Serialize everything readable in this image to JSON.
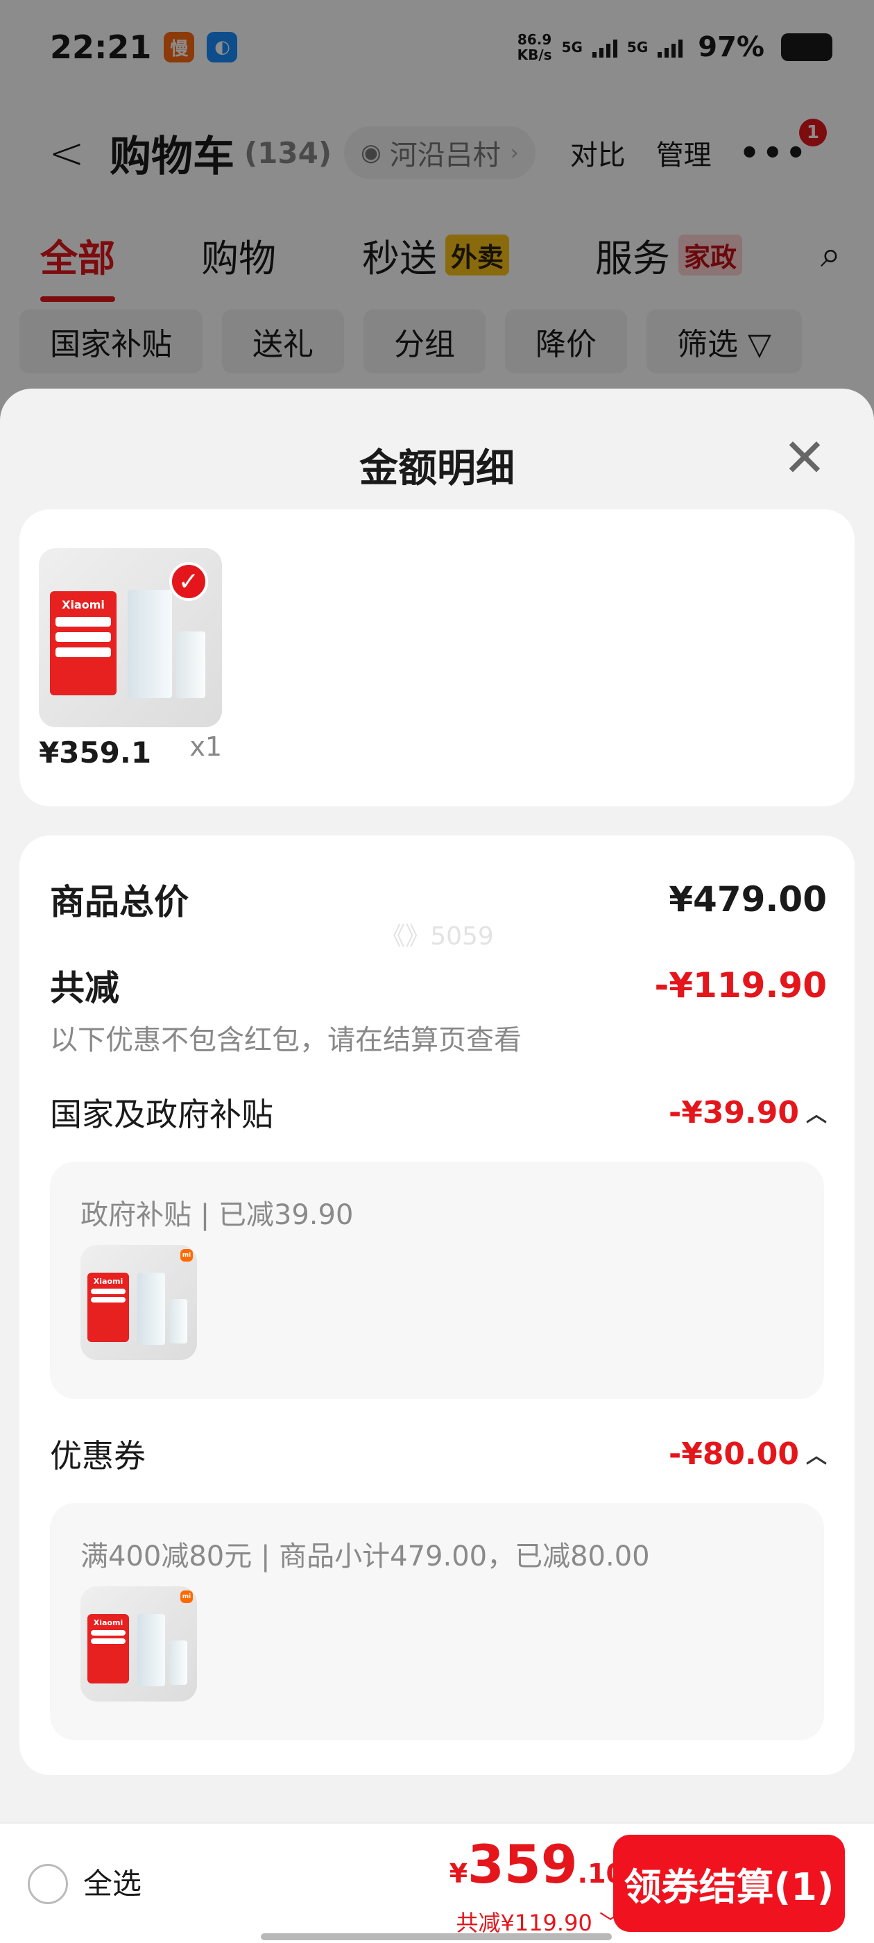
{
  "status_bar": {
    "time": "22:21",
    "speed_value": "86.9",
    "speed_unit": "KB/s",
    "net1": "5G",
    "net2": "5G",
    "battery": "97%",
    "app_badge1": "慢",
    "app_badge1_color": "#ff6a13",
    "app_badge2_color": "#1a8cff"
  },
  "header": {
    "back": "<",
    "title": "购物车",
    "count": "(134)",
    "location": "河沿吕村",
    "compare": "对比",
    "manage": "管理",
    "more_badge": "1"
  },
  "tabs": [
    {
      "label": "全部",
      "badge": ""
    },
    {
      "label": "购物",
      "badge": ""
    },
    {
      "label": "秒送",
      "badge": "外卖"
    },
    {
      "label": "服务",
      "badge": "家政"
    }
  ],
  "filters": [
    "国家补贴",
    "送礼",
    "分组",
    "降价",
    "筛选 ▽"
  ],
  "sheet": {
    "title": "金额明细",
    "product": {
      "price": "¥359.1",
      "qty": "x1",
      "poster_text": "Xiaomi",
      "brand_mark": "mi"
    },
    "total_label": "商品总价",
    "total_value": "¥479.00",
    "discount_label": "共减",
    "discount_value": "-¥119.90",
    "discount_note": "以下优惠不包含红包，请在结算页查看",
    "gov": {
      "label": "国家及政府补贴",
      "value": "-¥39.90",
      "detail": "政府补贴 | 已减39.90"
    },
    "coupon": {
      "label": "优惠券",
      "value": "-¥80.00",
      "detail": "满400减80元 | 商品小计479.00，已减80.00"
    },
    "watermark": "《》5059"
  },
  "bottom_bar": {
    "select_all": "全选",
    "currency": "¥",
    "amount_int": "359",
    "amount_dec": ".10",
    "saved": "共减¥119.90",
    "checkout": "领券结算(1)"
  },
  "colors": {
    "accent": "#e4161c",
    "checkout_bg": "#f0131f"
  }
}
